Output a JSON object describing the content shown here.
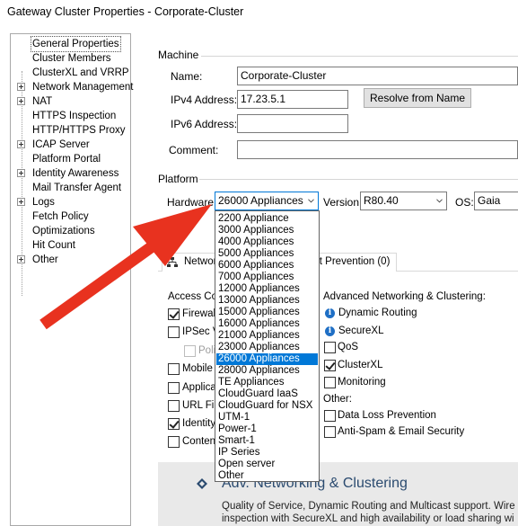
{
  "window": {
    "title": "Gateway Cluster Properties - Corporate-Cluster"
  },
  "tree": {
    "items": [
      {
        "label": "General Properties",
        "expandable": false,
        "selected": true
      },
      {
        "label": "Cluster Members",
        "expandable": false
      },
      {
        "label": "ClusterXL and VRRP",
        "expandable": false
      },
      {
        "label": "Network Management",
        "expandable": true
      },
      {
        "label": "NAT",
        "expandable": true
      },
      {
        "label": "HTTPS Inspection",
        "expandable": false
      },
      {
        "label": "HTTP/HTTPS Proxy",
        "expandable": false
      },
      {
        "label": "ICAP Server",
        "expandable": true
      },
      {
        "label": "Platform Portal",
        "expandable": false
      },
      {
        "label": "Identity Awareness",
        "expandable": true
      },
      {
        "label": "Mail Transfer Agent",
        "expandable": false
      },
      {
        "label": "Logs",
        "expandable": true
      },
      {
        "label": "Fetch Policy",
        "expandable": false
      },
      {
        "label": "Optimizations",
        "expandable": false
      },
      {
        "label": "Hit Count",
        "expandable": false
      },
      {
        "label": "Other",
        "expandable": true
      }
    ]
  },
  "machine": {
    "section_label": "Machine",
    "name_label": "Name:",
    "name_value": "Corporate-Cluster",
    "ipv4_label": "IPv4 Address:",
    "ipv4_value": "17.23.5.1",
    "resolve_label": "Resolve from Name",
    "ipv6_label": "IPv6 Address:",
    "ipv6_value": "",
    "comment_label": "Comment:",
    "comment_value": ""
  },
  "platform": {
    "section_label": "Platform",
    "hardware_label": "Hardware:",
    "hardware_value": "26000 Appliances",
    "version_label": "Version:",
    "version_value": "R80.40",
    "os_label": "OS:",
    "os_value": "Gaia"
  },
  "tabs": [
    {
      "label": "Network"
    },
    {
      "label": "eat Prevention (0)"
    }
  ],
  "access_control": {
    "header": "Access Co",
    "items": [
      {
        "label": "Firewall",
        "checked": true
      },
      {
        "label": "IPSec V",
        "checked": false
      },
      {
        "label": "Polic",
        "checked": false,
        "disabled": true
      },
      {
        "label": "Mobile A",
        "checked": false
      },
      {
        "label": "Applicat",
        "checked": false
      },
      {
        "label": "URL Filt",
        "checked": false
      },
      {
        "label": "Identity",
        "checked": true
      },
      {
        "label": "Content",
        "checked": false
      }
    ]
  },
  "advanced": {
    "header": "Advanced Networking & Clustering:",
    "dynamic_routing": "Dynamic Routing",
    "securexl": "SecureXL",
    "qos": "QoS",
    "clusterxl": "ClusterXL",
    "monitoring": "Monitoring",
    "other_header": "Other:",
    "dlp": "Data Loss Prevention",
    "antispam": "Anti-Spam & Email Security",
    "states": {
      "qos": false,
      "clusterxl": true,
      "monitoring": false,
      "dlp": false,
      "antispam": false
    }
  },
  "adv_panel": {
    "title": "Adv. Networking & Clustering",
    "desc_line1": "Quality of Service, Dynamic Routing and Multicast support. Wire",
    "desc_line2": "inspection with SecureXL and high availability or load sharing wi"
  },
  "dropdown": {
    "selected": "26000 Appliances",
    "options": [
      "2200 Appliance",
      "3000 Appliances",
      "4000 Appliances",
      "5000 Appliances",
      "6000 Appliances",
      "7000 Appliances",
      "12000 Appliances",
      "13000 Appliances",
      "15000 Appliances",
      "16000 Appliances",
      "21000 Appliances",
      "23000 Appliances",
      "26000 Appliances",
      "28000 Appliances",
      "TE Appliances",
      "CloudGuard IaaS",
      "CloudGuard for NSX",
      "UTM-1",
      "Power-1",
      "Smart-1",
      "IP Series",
      "Open server",
      "Other"
    ]
  },
  "colors": {
    "selection_blue": "#0078d7",
    "arrow_red": "#e8321f",
    "info_blue": "#1f6fc5",
    "panel_gray": "#e9e9e9"
  }
}
